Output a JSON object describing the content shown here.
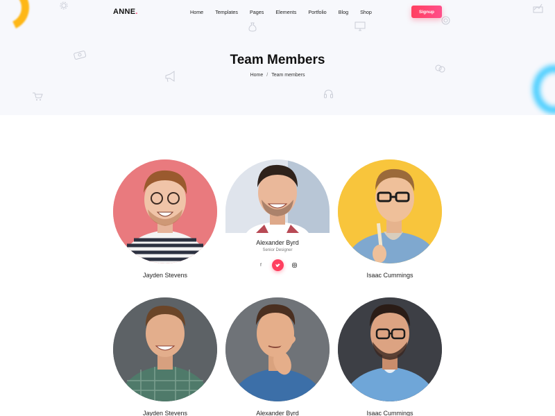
{
  "brand": {
    "name": "ANNE",
    "dot": "."
  },
  "nav": {
    "items": [
      "Home",
      "Templates",
      "Pages",
      "Elements",
      "Portfolio",
      "Blog",
      "Shop"
    ]
  },
  "header": {
    "signup_label": "Signup"
  },
  "hero": {
    "title": "Team Members",
    "breadcrumb": {
      "home": "Home",
      "separator": "/",
      "current": "Team members"
    }
  },
  "team": [
    {
      "name": "Jayden Stevens",
      "bg": "#e97a7e"
    },
    {
      "name": "Alexander Byrd",
      "role": "Senior Designer",
      "bg": "#dfe4ec",
      "socials": [
        "f",
        "t",
        "i"
      ]
    },
    {
      "name": "Isaac Cummings",
      "bg": "#f8c53c"
    },
    {
      "name": "Jayden Stevens",
      "bg": "#5d6266"
    },
    {
      "name": "Alexander Byrd",
      "bg": "#6f7378"
    },
    {
      "name": "Isaac Cummings",
      "bg": "#3d3f45"
    }
  ],
  "colors": {
    "accent": "#ff3f5f",
    "hero_bg": "#f7f8fc"
  },
  "icons": [
    "settings-icon",
    "money-bag-icon",
    "monitor-icon",
    "chart-icon",
    "cart-icon",
    "megaphone-icon",
    "headset-icon",
    "chat-icon",
    "money-icon"
  ]
}
